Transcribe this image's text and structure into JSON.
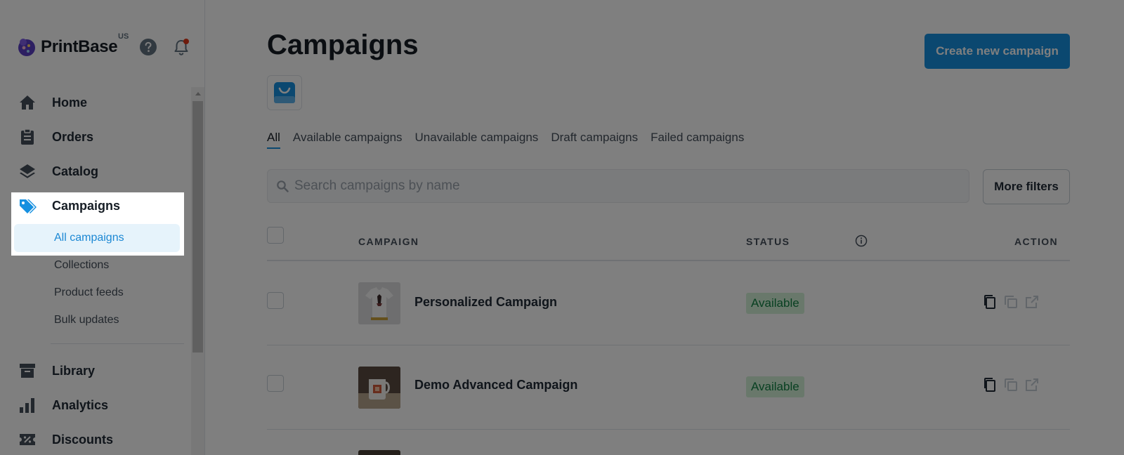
{
  "brand": {
    "name": "PrintBase",
    "region": "US"
  },
  "nav": {
    "home": "Home",
    "orders": "Orders",
    "catalog": "Catalog",
    "campaigns": "Campaigns",
    "sub": {
      "all_campaigns": "All campaigns",
      "collections": "Collections",
      "product_feeds": "Product feeds",
      "bulk_updates": "Bulk updates"
    },
    "library": "Library",
    "analytics": "Analytics",
    "discounts": "Discounts"
  },
  "header": {
    "title": "Campaigns",
    "create_button": "Create new campaign"
  },
  "tabs": [
    "All",
    "Available campaigns",
    "Unavailable campaigns",
    "Draft campaigns",
    "Failed campaigns"
  ],
  "search": {
    "placeholder": "Search campaigns by name",
    "value": ""
  },
  "filters": {
    "more_filters": "More filters"
  },
  "table": {
    "columns": {
      "campaign": "CAMPAIGN",
      "status": "STATUS",
      "action": "ACTION"
    },
    "rows": [
      {
        "name": "Personalized Campaign",
        "status": "Available"
      },
      {
        "name": "Demo Advanced Campaign",
        "status": "Available"
      }
    ]
  },
  "colors": {
    "accent": "#1690e0",
    "status_available_bg": "#d3f1d6",
    "status_available_text": "#108043",
    "notification_dot": "#de3618"
  },
  "icons": {
    "help": "question-circle-icon",
    "notifications": "bell-icon",
    "search": "search-icon",
    "info": "info-icon",
    "duplicate": "copy-icon",
    "clone": "clone-icon",
    "open": "external-link-icon"
  }
}
